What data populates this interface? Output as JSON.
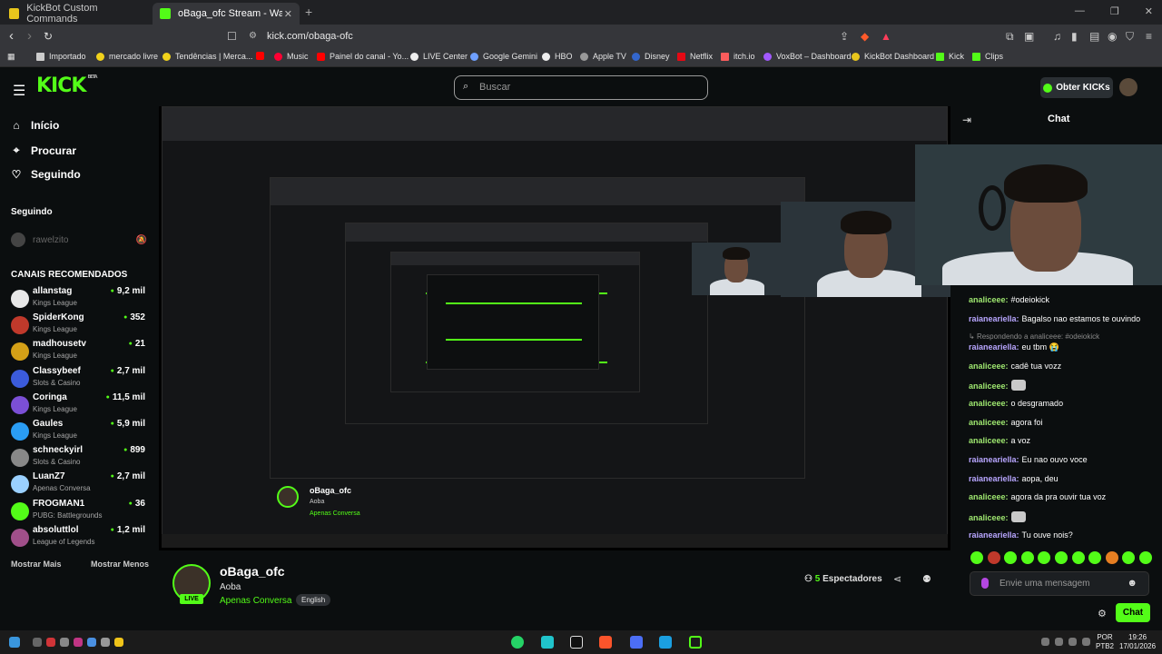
{
  "browser": {
    "tabs": [
      {
        "label": "KickBot Custom Commands",
        "active": false
      },
      {
        "label": "oBaga_ofc Stream - Watch Li...",
        "active": true
      }
    ],
    "url": "kick.com/obaga-ofc",
    "bookmarks": [
      "Importado",
      "mercado livre",
      "Tendências | Merca...",
      "Music",
      "Painel do canal - Yo...",
      "LIVE Center",
      "Google Gemini",
      "HBO",
      "Apple TV",
      "Disney",
      "Netflix",
      "itch.io",
      "VoxBot – Dashboard",
      "KickBot Dashboard",
      "Kick",
      "Clips"
    ]
  },
  "header": {
    "logo": "KICK",
    "logo_sup": "BETA",
    "search_placeholder": "Buscar",
    "kicks_button": "Obter KICKs"
  },
  "sidebar": {
    "nav": [
      {
        "label": "Início",
        "icon": "home-icon"
      },
      {
        "label": "Procurar",
        "icon": "compass-icon"
      },
      {
        "label": "Seguindo",
        "icon": "heart-icon"
      }
    ],
    "following_title": "Seguindo",
    "following_user": "rawelzito",
    "recommended_title": "CANAIS RECOMENDADOS",
    "channels": [
      {
        "name": "allanstag",
        "category": "Kings League",
        "viewers": "9,2 mil",
        "color": "#e8e8e8"
      },
      {
        "name": "SpiderKong",
        "category": "Kings League",
        "viewers": "352",
        "color": "#c0392b"
      },
      {
        "name": "madhousetv",
        "category": "Kings League",
        "viewers": "21",
        "color": "#d4a017"
      },
      {
        "name": "Classybeef",
        "category": "Slots & Casino",
        "viewers": "2,7 mil",
        "color": "#3b5bdb"
      },
      {
        "name": "Coringa",
        "category": "Kings League",
        "viewers": "11,5 mil",
        "color": "#7b4fd6"
      },
      {
        "name": "Gaules",
        "category": "Kings League",
        "viewers": "5,9 mil",
        "color": "#2a9df4"
      },
      {
        "name": "schneckyirl",
        "category": "Slots & Casino",
        "viewers": "899",
        "color": "#888888"
      },
      {
        "name": "LuanZ7",
        "category": "Apenas Conversa",
        "viewers": "2,7 mil",
        "color": "#9ad0ff"
      },
      {
        "name": "FROGMAN1",
        "category": "PUBG: Battlegrounds",
        "viewers": "36",
        "color": "#53fc18"
      },
      {
        "name": "absoluttlol",
        "category": "League of Legends",
        "viewers": "1,2 mil",
        "color": "#a04f8a"
      }
    ],
    "show_more": "Mostrar Mais",
    "show_less": "Mostrar Menos"
  },
  "stream": {
    "streamer": "oBaga_ofc",
    "title": "Aoba",
    "category": "Apenas Conversa",
    "language": "English",
    "live_label": "LIVE",
    "viewers_count": "5",
    "viewers_label": "Espectadores"
  },
  "chat": {
    "title": "Chat",
    "messages": [
      {
        "user": "analiceee:",
        "text": "#odeiokick",
        "kind": "g"
      },
      {
        "user": "raianeariella:",
        "text": "Bagalso nao estamos te ouvindo",
        "kind": "p"
      },
      {
        "reply": "Respondendo a analiceee: #odeiokick"
      },
      {
        "user": "raianeariella:",
        "text": "eu tbm 😭",
        "kind": "p"
      },
      {
        "user": "analiceee:",
        "text": "cadê tua vozz",
        "kind": "g"
      },
      {
        "user": "analiceee:",
        "text": "",
        "kind": "g",
        "emote": true
      },
      {
        "user": "analiceee:",
        "text": "o desgramado",
        "kind": "g"
      },
      {
        "user": "analiceee:",
        "text": "agora foi",
        "kind": "g"
      },
      {
        "user": "analiceee:",
        "text": "a voz",
        "kind": "g"
      },
      {
        "user": "raianeariella:",
        "text": "Eu nao ouvo voce",
        "kind": "p"
      },
      {
        "user": "raianeariella:",
        "text": "aopa, deu",
        "kind": "p"
      },
      {
        "user": "analiceee:",
        "text": "agora da pra ouvir tua voz",
        "kind": "g"
      },
      {
        "user": "analiceee:",
        "text": "",
        "kind": "g",
        "emote": true
      },
      {
        "user": "raianeariella:",
        "text": "Tu ouve nois?",
        "kind": "p"
      }
    ],
    "input_placeholder": "Envie uma mensagem",
    "send_label": "Chat"
  },
  "taskbar": {
    "lang_top": "POR",
    "lang_bottom": "PTB2",
    "time": "19:26",
    "date": "17/01/2026"
  },
  "colors": {
    "accent": "#53fc18",
    "chat_green": "#9fe870",
    "chat_purple": "#b8a6ff"
  }
}
